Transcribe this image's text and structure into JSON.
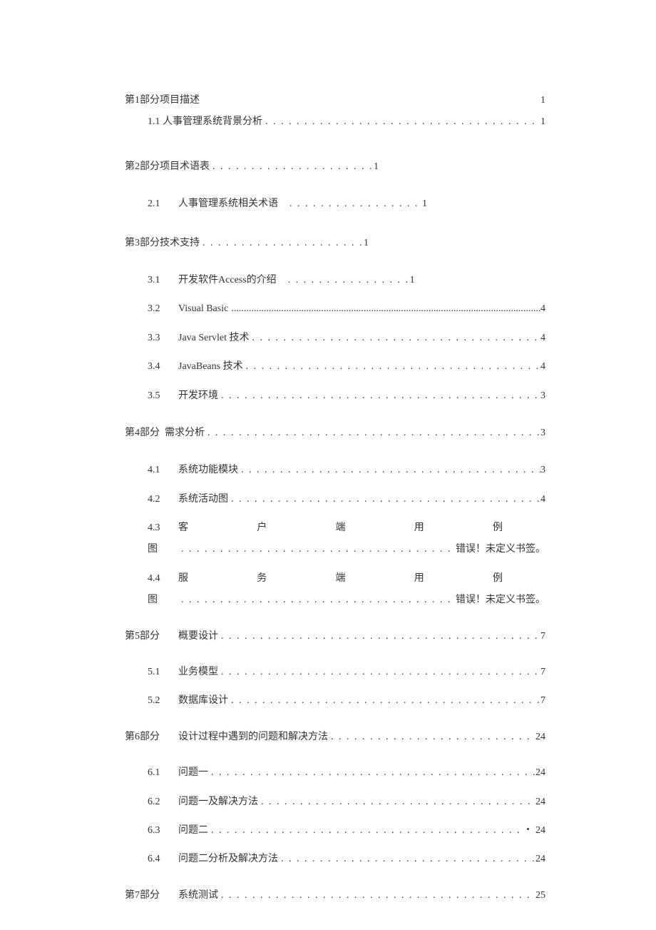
{
  "toc": {
    "p1": {
      "num": "第1部分",
      "label": "项目描述",
      "page": "1"
    },
    "p1_1": {
      "num": "1.1",
      "label": "人事管理系统背景分析",
      "page": "1"
    },
    "p2": {
      "num": "第2部分",
      "label": "项目术语表",
      "page": "1"
    },
    "p2_1": {
      "num": "2.1",
      "label": "人事管理系统相关术语",
      "page": "1"
    },
    "p3": {
      "num": "第3部分",
      "label": "技术支持",
      "page": "1"
    },
    "p3_1": {
      "num": "3.1",
      "label": "开发软件Access的介绍",
      "page": "1"
    },
    "p3_2": {
      "num": "3.2",
      "label": "Visual Basic",
      "page": "4"
    },
    "p3_3": {
      "num": "3.3",
      "label": "Java Servlet 技术",
      "page": "4"
    },
    "p3_4": {
      "num": "3.4",
      "label": "JavaBeans 技术",
      "page": "4"
    },
    "p3_5": {
      "num": "3.5",
      "label": "开发环境",
      "page": "3"
    },
    "p4": {
      "num": "第4部分",
      "label": "需求分析",
      "page": "3"
    },
    "p4_1": {
      "num": "4.1",
      "label": "系统功能模块",
      "page": "3"
    },
    "p4_2": {
      "num": "4.2",
      "label": "系统活动图",
      "page": "4"
    },
    "p4_3": {
      "num": "4.3",
      "label": "客户端用例",
      "label2": "图",
      "page": "错误！未定义书签。"
    },
    "p4_4": {
      "num": "4.4",
      "label": "服务端用例",
      "label2": "图",
      "page": "错误！未定义书签。"
    },
    "p5": {
      "num": "第5部分",
      "label": "概要设计",
      "page": "7"
    },
    "p5_1": {
      "num": "5.1",
      "label": "业务模型",
      "page": "7"
    },
    "p5_2": {
      "num": "5.2",
      "label": "数据库设计",
      "page": "7"
    },
    "p6": {
      "num": "第6部分",
      "label": "设计过程中遇到的问题和解决方法",
      "page": "24"
    },
    "p6_1": {
      "num": "6.1",
      "label": "问题一",
      "page": "24"
    },
    "p6_2": {
      "num": "6.2",
      "label": "问题一及解决方法",
      "page": "24"
    },
    "p6_3": {
      "num": "6.3",
      "label": "问题二",
      "page": "・ 24"
    },
    "p6_4": {
      "num": "6.4",
      "label": "问题二分析及解决方法",
      "page": "24"
    },
    "p7": {
      "num": "第7部分",
      "label": "系统测试",
      "page": "25"
    }
  },
  "dots": ". . . . . . . . . . . . . . . . . . . . . . . . . . . . . . . . . . . . . . . . . . . . . . . . . . . . . . . . . . . . . . . . . . . . . . . . . . . . . . . . . . . . . . . . . . . . . . . . . . . . . . . . . . . . . . . . . . . . . . . . . . . ."
}
